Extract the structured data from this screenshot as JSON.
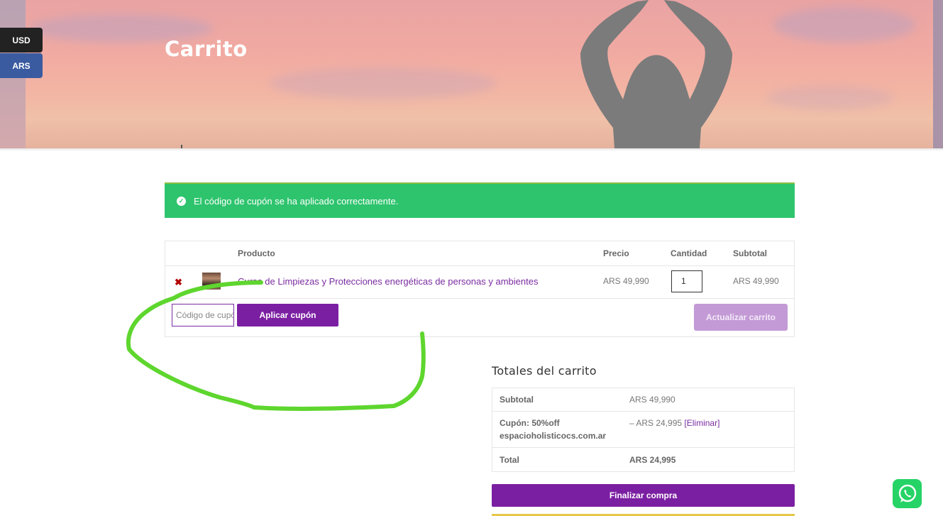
{
  "hero": {
    "title": "Carrito"
  },
  "currency": {
    "options": [
      "USD",
      "ARS"
    ],
    "selected": "ARS"
  },
  "notice": {
    "message": "El código de cupón se ha aplicado correctamente."
  },
  "cart": {
    "headers": {
      "product": "Producto",
      "price": "Precio",
      "quantity": "Cantidad",
      "subtotal": "Subtotal"
    },
    "items": [
      {
        "name": "Curso de Limpiezas y Protecciones energéticas de personas y ambientes",
        "price": "ARS 49,990",
        "quantity": "1",
        "subtotal": "ARS 49,990"
      }
    ],
    "coupon_placeholder": "Código de cupón",
    "apply_coupon_label": "Aplicar cupón",
    "update_cart_label": "Actualizar carrito"
  },
  "totals": {
    "title": "Totales del carrito",
    "subtotal_label": "Subtotal",
    "subtotal_value": "ARS 49,990",
    "coupon_label_line1": "Cupón: 50%off",
    "coupon_label_line2": "espacioholisticocs.com.ar",
    "coupon_value": "– ARS 24,995",
    "coupon_remove": "[Eliminar]",
    "total_label": "Total",
    "total_value": "ARS 24,995",
    "checkout_label": "Finalizar compra"
  },
  "colors": {
    "accent": "#7b1fa2",
    "success": "#2ec46d",
    "annotation": "#5ed62e",
    "whatsapp": "#25d366"
  },
  "icons": {
    "notice": "check-circle-icon",
    "remove": "remove-x-icon",
    "chat": "whatsapp-icon"
  }
}
